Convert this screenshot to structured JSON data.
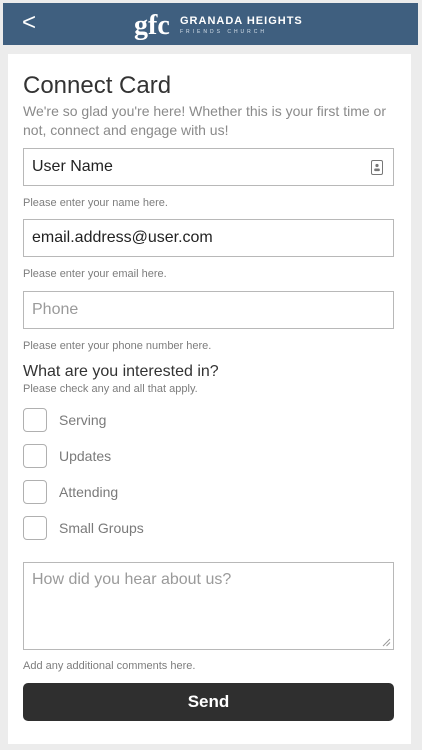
{
  "header": {
    "back_glyph": "<",
    "logo_name": "GRANADA HEIGHTS",
    "logo_sub": "FRIENDS CHURCH",
    "bg_color": "#3f5f7f"
  },
  "form": {
    "title": "Connect Card",
    "intro": "We're so glad you're here! Whether this is your first time or not, connect and engage with us!",
    "name": {
      "value": "User Name",
      "hint": "Please enter your name here.",
      "icon": "contact-card-icon"
    },
    "email": {
      "value": "email.address@user.com",
      "hint": "Please enter your email here."
    },
    "phone": {
      "placeholder": "Phone",
      "hint": "Please enter your phone number here."
    },
    "interests": {
      "title": "What are you interested in?",
      "subtitle": "Please check any and all that apply.",
      "options": [
        "Serving",
        "Updates",
        "Attending",
        "Small Groups"
      ]
    },
    "comments": {
      "placeholder": "How did you hear about us?",
      "hint": "Add any additional comments here."
    },
    "send_label": "Send"
  }
}
